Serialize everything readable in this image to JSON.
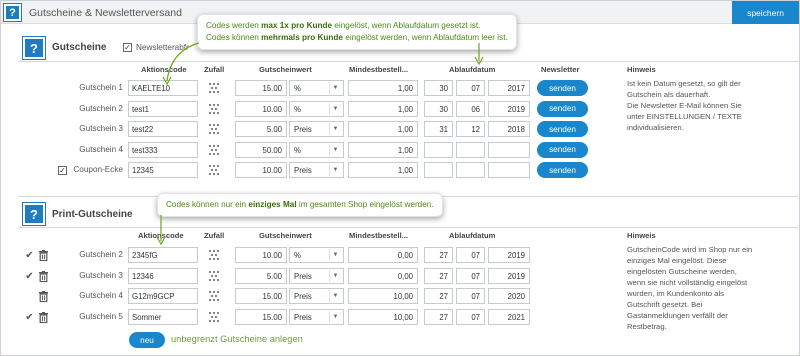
{
  "header": {
    "help": "?",
    "title": "Gutscheine & Newsletterversand",
    "save_label": "speichern"
  },
  "section1": {
    "help": "?",
    "title": "Gutscheine",
    "newsletter_checkbox_label": "Newsletterabfr",
    "columns": {
      "code": "Aktionscode",
      "random": "Zufall",
      "value": "Gutscheinwert",
      "min": "Mindestbestell...",
      "expiry": "Ablaufdatum",
      "newsletter": "Newsletter",
      "hint": "Hinweis"
    },
    "rows": [
      {
        "label": "Gutschein 1",
        "code": "KAELTE10",
        "value": "15.00",
        "unit": "%",
        "min": "1,00",
        "day": "30",
        "month": "07",
        "year": "2017",
        "send": "senden"
      },
      {
        "label": "Gutschein 2",
        "code": "test1",
        "value": "10.00",
        "unit": "%",
        "min": "1,00",
        "day": "30",
        "month": "06",
        "year": "2019",
        "send": "senden"
      },
      {
        "label": "Gutschein 3",
        "code": "test22",
        "value": "5.00",
        "unit": "Preis",
        "min": "1,00",
        "day": "31",
        "month": "12",
        "year": "2018",
        "send": "senden"
      },
      {
        "label": "Gutschein 4",
        "code": "test333",
        "value": "50.00",
        "unit": "%",
        "min": "1,00",
        "day": "",
        "month": "",
        "year": "",
        "send": "senden"
      },
      {
        "label": "Coupon-Ecke",
        "code": "12345",
        "value": "10.00",
        "unit": "Preis",
        "min": "1,00",
        "day": "",
        "month": "",
        "year": "",
        "send": "senden"
      }
    ],
    "hint_lines": [
      "Ist kein Datum gesetzt, so gilt der",
      "Gutschein als dauerhaft.",
      "Die Newsletter E-Mail können Sie",
      "unter EINSTELLUNGEN / TEXTE",
      "individualisieren."
    ],
    "tooltip": {
      "l1_pre": "Codes werden ",
      "l1_bold": "max 1x pro Kunde",
      "l1_post": " eingelöst, wenn Ablaufdatum gesetzt ist.",
      "l2_pre": "Codes können ",
      "l2_bold": "mehrmals pro Kunde",
      "l2_post": " eingelöst werden, wenn Ablaufdatum leer ist."
    }
  },
  "section2": {
    "help": "?",
    "title": "Print-Gutscheine",
    "columns": {
      "code": "Aktionscode",
      "random": "Zufall",
      "value": "Gutscheinwert",
      "min": "Mindestbestell...",
      "expiry": "Ablaufdatum",
      "hint": "Hinweis"
    },
    "rows": [
      {
        "label": "Gutschein 2",
        "code": "2345fG",
        "value": "10.00",
        "unit": "%",
        "min": "0,00",
        "day": "27",
        "month": "07",
        "year": "2019",
        "check": true
      },
      {
        "label": "Gutschein 3",
        "code": "12346",
        "value": "5.00",
        "unit": "Preis",
        "min": "0,00",
        "day": "27",
        "month": "07",
        "year": "2019",
        "check": true
      },
      {
        "label": "Gutschein 4",
        "code": "G12m9GCP",
        "value": "15.00",
        "unit": "Preis",
        "min": "10,00",
        "day": "27",
        "month": "07",
        "year": "2020",
        "check": false
      },
      {
        "label": "Gutschein 5",
        "code": "Sommer",
        "value": "15.00",
        "unit": "Preis",
        "min": "10,00",
        "day": "27",
        "month": "07",
        "year": "2021",
        "check": true
      }
    ],
    "hint_lines": [
      "GutscheinCode wird im Shop nur ein",
      "einziges Mal eingelöst. Diese",
      "eingelösten Gutscheine werden,",
      "wenn sie nicht vollständig eingelöst",
      "wurden, im Kundenkonto als",
      "Gutschrift gesetzt. Bei",
      "Gastanmeldungen verfällt der",
      "Restbetrag."
    ],
    "tooltip": {
      "pre": "Codes können nur ein ",
      "bold": "einziges Mal",
      "post": " im gesamten Shop eingelöst werden."
    },
    "new_button": "neu",
    "unlimited_link": "unbegrenzt Gutscheine anlegen"
  },
  "icons": {
    "random": "dice-icon",
    "delete": "trash-icon",
    "done": "checkmark-icon"
  },
  "colors": {
    "accent": "#1a86cc",
    "tooltip_text": "#4f8a10"
  }
}
